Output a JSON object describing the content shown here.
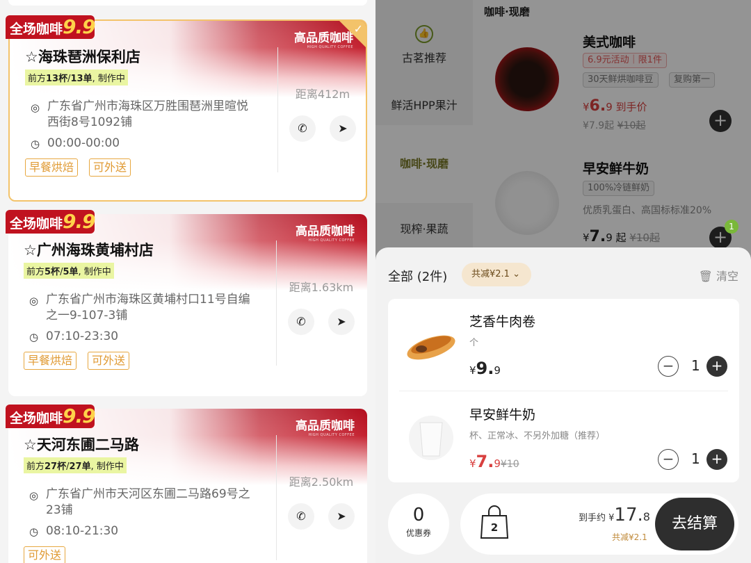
{
  "stores": [
    {
      "badge_text": "全场咖啡",
      "badge_num": "9.9",
      "hq": "高品质咖啡",
      "hq_en": "HIGH QUALITY COFFEE",
      "name": "海珠琶洲保利店",
      "queue_pre": "前方",
      "queue_cups": "13杯",
      "queue_mid": "/",
      "queue_orders": "13单",
      "queue_post": ", 制作中",
      "addr": "广东省广州市海珠区万胜围琶洲里暄悦西街8号1092铺",
      "hours": "00:00-00:00",
      "distance": "距离412m",
      "tags": [
        "早餐烘焙",
        "可外送"
      ],
      "selected": true
    },
    {
      "badge_text": "全场咖啡",
      "badge_num": "9.9",
      "hq": "高品质咖啡",
      "hq_en": "HIGH QUALITY COFFEE",
      "name": "广州海珠黄埔村店",
      "queue_pre": "前方",
      "queue_cups": "5杯",
      "queue_mid": "/",
      "queue_orders": "5单",
      "queue_post": ", 制作中",
      "addr": "广东省广州市海珠区黄埔村口11号自编之一9-107-3铺",
      "hours": "07:10-23:30",
      "distance": "距离1.63km",
      "tags": [
        "早餐烘焙",
        "可外送"
      ],
      "selected": false
    },
    {
      "badge_text": "全场咖啡",
      "badge_num": "9.9",
      "hq": "高品质咖啡",
      "hq_en": "HIGH QUALITY COFFEE",
      "name": "天河东圃二马路",
      "queue_pre": "前方",
      "queue_cups": "27杯",
      "queue_mid": "/",
      "queue_orders": "27单",
      "queue_post": ", 制作中",
      "addr": "广东省广州市天河区东圃二马路69号之23铺",
      "hours": "08:10-21:30",
      "distance": "距离2.50km",
      "tags": [
        "可外送"
      ],
      "selected": false
    }
  ],
  "menu": {
    "section_label": "咖啡·现磨",
    "categories": [
      "古茗推荐",
      "鲜活HPP果汁",
      "咖啡·现磨",
      "现榨·果蔬"
    ],
    "products": [
      {
        "name": "美式咖啡",
        "tag1": "6.9元活动｜限1件",
        "tag2": "30天鲜烘咖啡豆",
        "tag3": "复购第一",
        "price_sym": "¥",
        "price_int": "6.",
        "price_dec": "9",
        "price_suffix": "到手价",
        "old": "¥7.9起",
        "old_strike": "¥10起"
      },
      {
        "name": "早安鲜牛奶",
        "tag1": "100%冷链鲜奶",
        "desc": "优质乳蛋白、高国标标准20%",
        "price_sym": "¥",
        "price_int": "7.",
        "price_dec": "9",
        "price_suffix": "起",
        "old_strike": "¥10起",
        "cart_count": "1"
      }
    ]
  },
  "cart": {
    "title": "全部 (2件)",
    "saving": "共减¥2.1",
    "clear": "清空",
    "items": [
      {
        "name": "芝香牛肉卷",
        "spec": "个",
        "price_sym": "¥",
        "price_int": "9.",
        "price_dec": "9",
        "old": "",
        "qty": "1"
      },
      {
        "name": "早安鲜牛奶",
        "spec": "杯、正常冰、不另外加糖（推荐）",
        "price_sym": "¥",
        "price_int": "7.",
        "price_dec": "9",
        "old": "¥10",
        "qty": "1"
      }
    ],
    "coupon_count": "0",
    "coupon_label": "优惠券",
    "bag_count": "2",
    "total_label": "到手约 ¥",
    "total_int": "17.",
    "total_dec": "8",
    "total_save": "共减¥2.1",
    "checkout": "去结算"
  },
  "colors": {
    "brand_red": "#c0121f",
    "accent_gold": "#f3c36a",
    "price_red": "#d8403f",
    "dark": "#2e2e2e"
  }
}
